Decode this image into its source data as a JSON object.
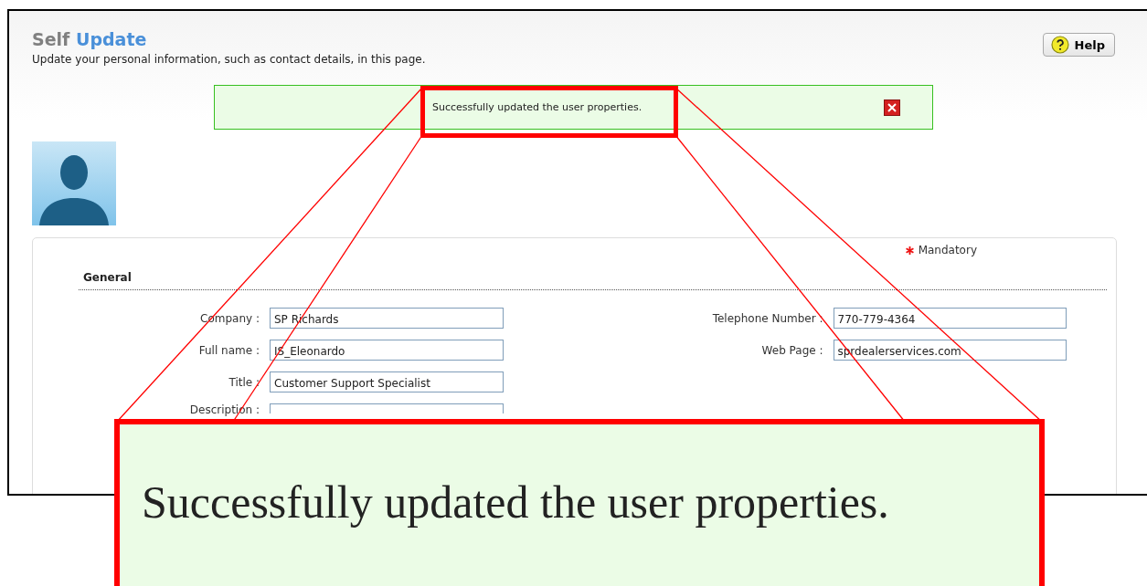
{
  "header": {
    "title_part1": "Self",
    "title_part2": "Update",
    "subtitle": "Update your personal information, such as contact details, in this page.",
    "help_button": "Help"
  },
  "banner": {
    "message": "Successfully updated the user properties."
  },
  "form": {
    "mandatory": "Mandatory",
    "section": "General",
    "left_fields": [
      {
        "label": "Company :",
        "value": "SP Richards"
      },
      {
        "label": "Full name :",
        "value": "IS_Eleonardo"
      },
      {
        "label": "Title :",
        "value": "Customer Support Specialist"
      },
      {
        "label": "Description :"
      }
    ],
    "right_fields": [
      {
        "label": "Telephone Number :",
        "value": "770-779-4364"
      },
      {
        "label": "Web Page :",
        "value": "sprdealerservices.com"
      }
    ]
  },
  "callout": {
    "text": "Successfully updated the user properties."
  }
}
